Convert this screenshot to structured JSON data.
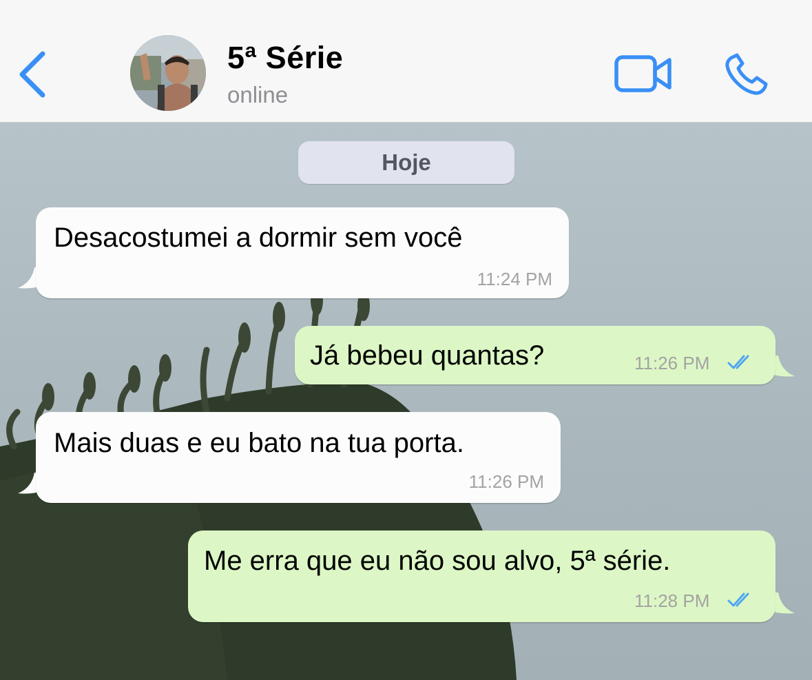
{
  "header": {
    "contact_name": "5ª Série",
    "contact_status": "online",
    "back_icon": "chevron-left-icon",
    "video_icon": "video-camera-icon",
    "call_icon": "phone-icon",
    "accent_color": "#3a8ff5"
  },
  "chat": {
    "date_label": "Hoje",
    "messages": [
      {
        "direction": "incoming",
        "text": "Desacostumei a dormir sem você",
        "time": "11:24 PM"
      },
      {
        "direction": "outgoing",
        "text": "Já bebeu quantas?",
        "time": "11:26 PM",
        "status": "read"
      },
      {
        "direction": "incoming",
        "text": "Mais duas e eu bato na tua porta.",
        "time": "11:26 PM"
      },
      {
        "direction": "outgoing",
        "text": "Me erra que eu não sou alvo, 5ª série.",
        "time": "11:28 PM",
        "status": "read"
      }
    ],
    "colors": {
      "incoming_bubble": "#fcfcfc",
      "outgoing_bubble": "#dcf7c5",
      "read_ticks": "#4fa6f0"
    }
  }
}
